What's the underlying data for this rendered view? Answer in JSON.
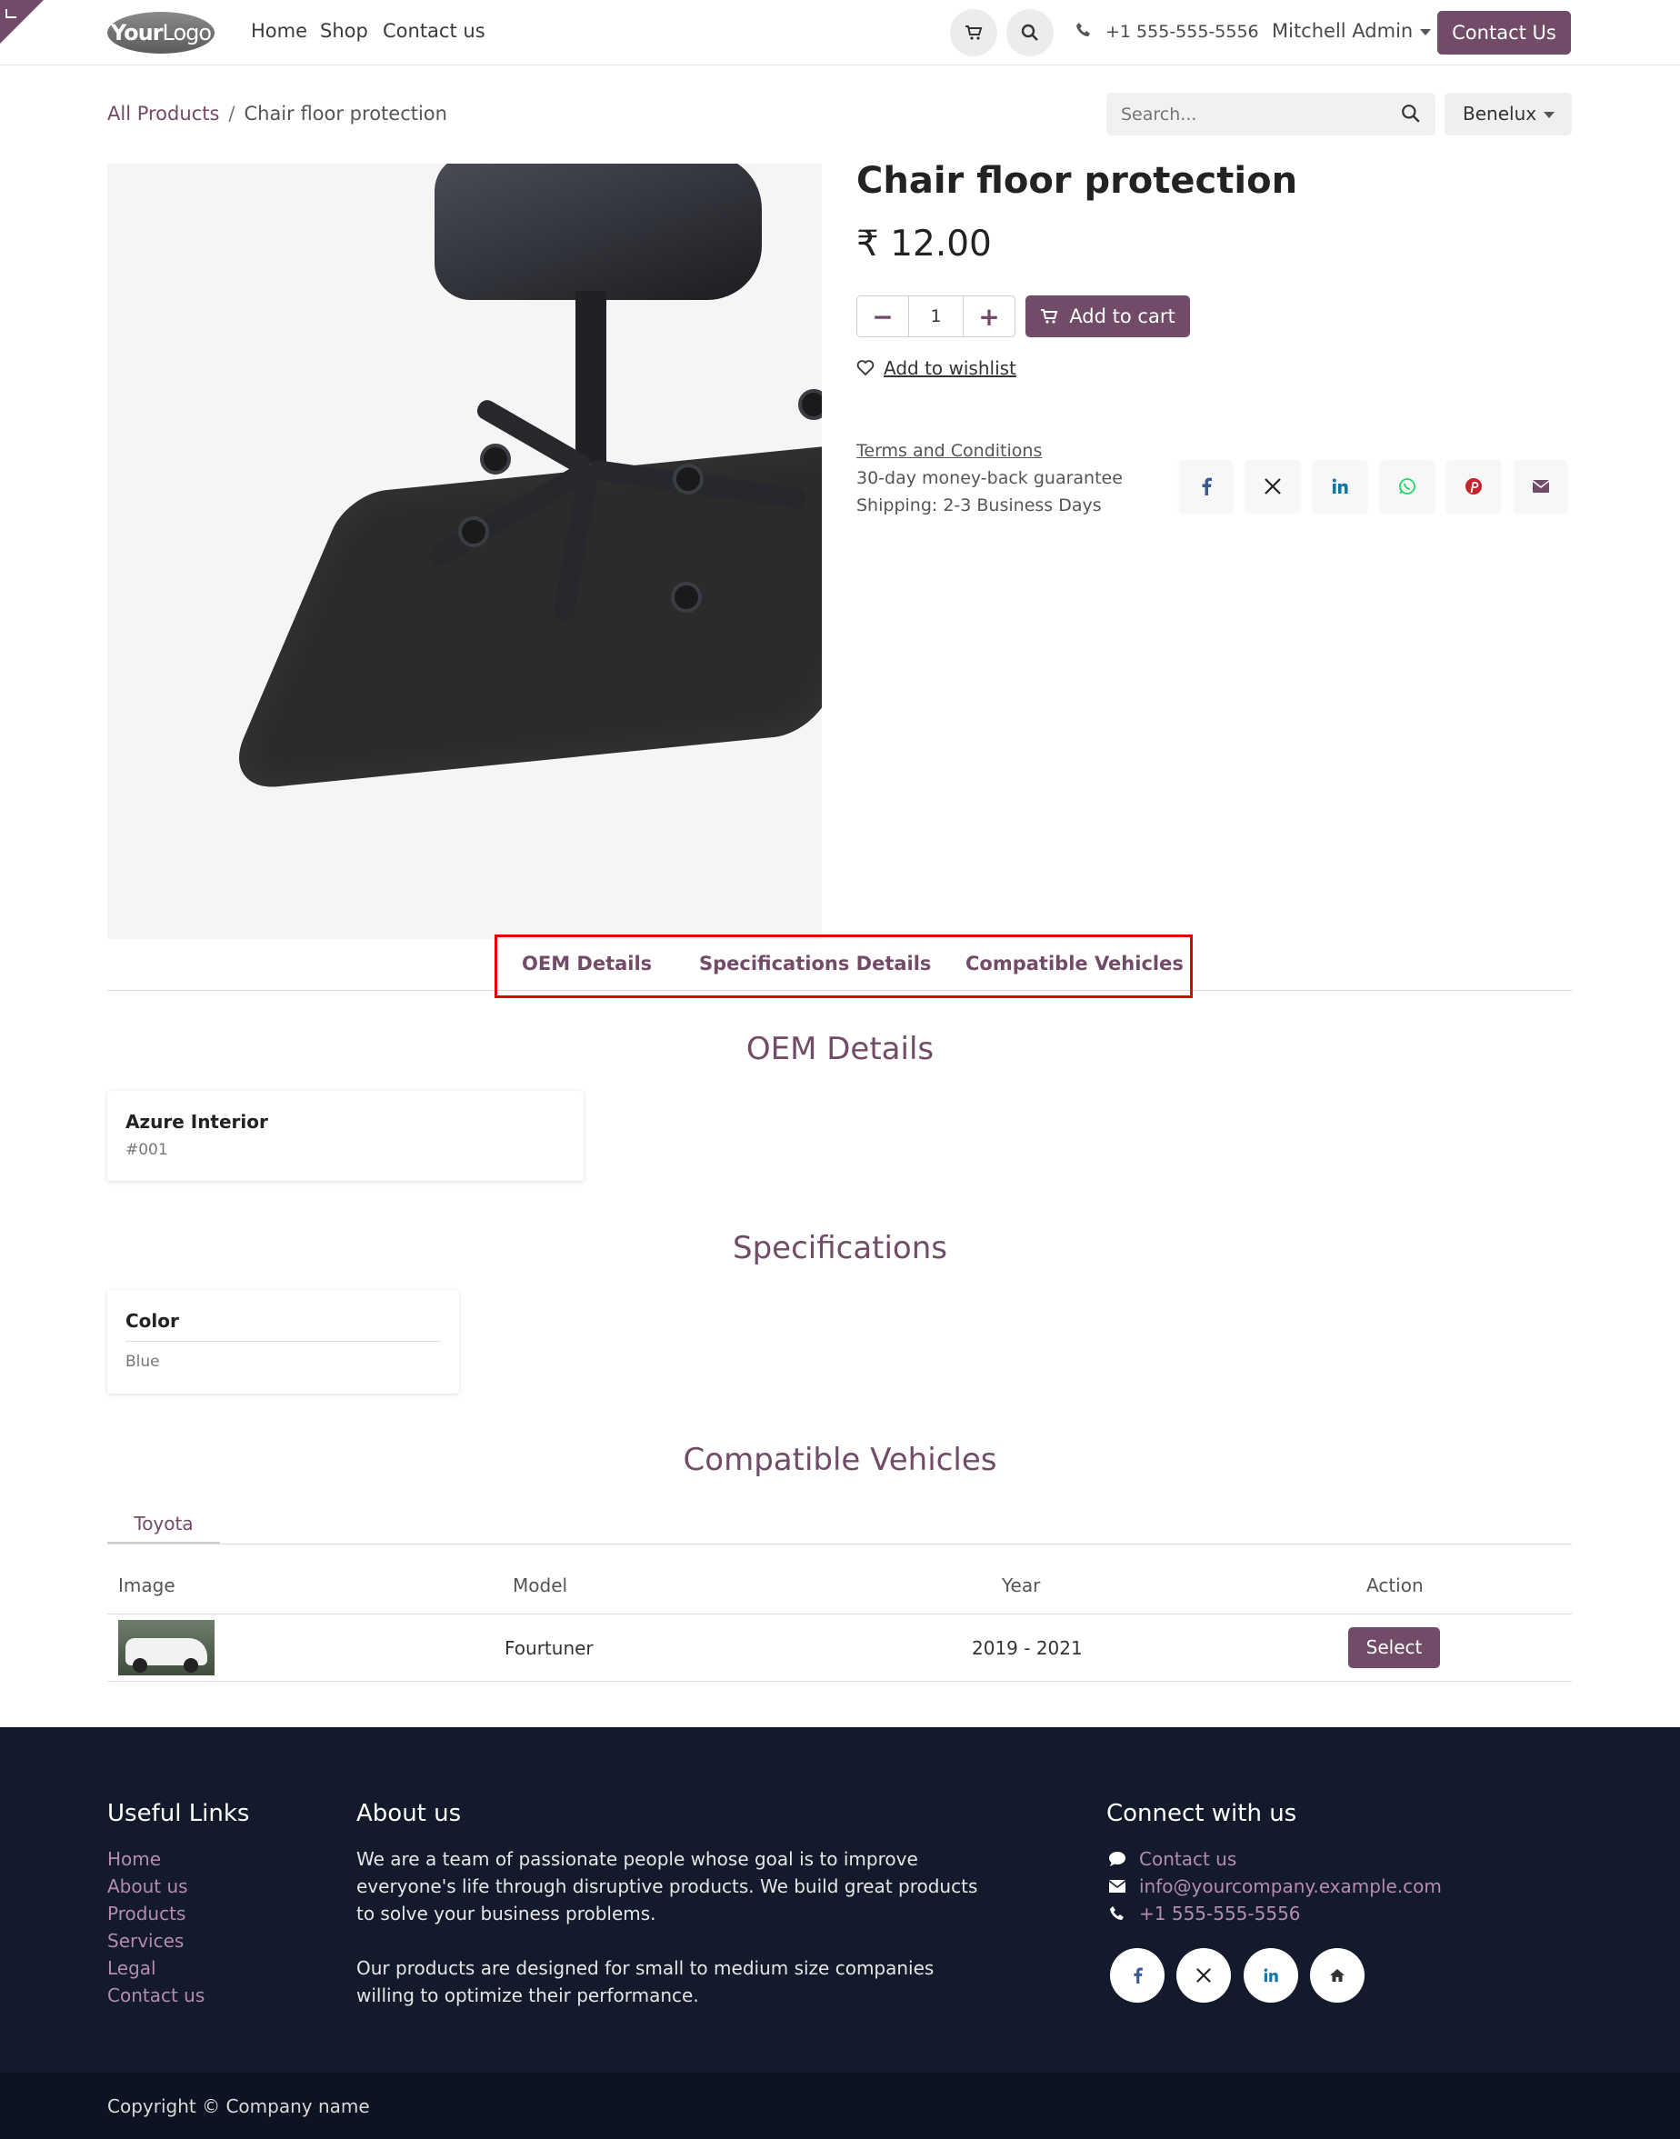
{
  "header": {
    "logo_text": "YourLogo",
    "nav": [
      "Home",
      "Shop",
      "Contact us"
    ],
    "phone": "+1 555-555-5556",
    "user": "Mitchell Admin",
    "contact_button": "Contact Us"
  },
  "breadcrumb": {
    "root": "All Products",
    "current": "Chair floor protection"
  },
  "search": {
    "placeholder": "Search..."
  },
  "pricelist": "Benelux",
  "product": {
    "name": "Chair floor protection",
    "price": "₹ 12.00",
    "quantity": "1",
    "add_to_cart": "Add to cart",
    "wishlist": "Add to wishlist",
    "terms": "Terms and Conditions",
    "guarantee": "30-day money-back guarantee",
    "shipping": "Shipping: 2-3 Business Days",
    "share_icons": [
      "facebook-icon",
      "x-icon",
      "linkedin-icon",
      "whatsapp-icon",
      "pinterest-icon",
      "email-icon"
    ]
  },
  "tabs": [
    "OEM Details",
    "Specifications Details",
    "Compatible Vehicles"
  ],
  "oem": {
    "title": "OEM Details",
    "name": "Azure Interior",
    "code": "#001"
  },
  "specs": {
    "title": "Specifications",
    "label": "Color",
    "value": "Blue"
  },
  "vehicles": {
    "title": "Compatible Vehicles",
    "brand_tab": "Toyota",
    "columns": [
      "Image",
      "Model",
      "Year",
      "Action"
    ],
    "rows": [
      {
        "model": "Fourtuner",
        "year": "2019 - 2021",
        "action": "Select"
      }
    ]
  },
  "footer": {
    "useful_links_title": "Useful Links",
    "useful_links": [
      "Home",
      "About us",
      "Products",
      "Services",
      "Legal",
      "Contact us"
    ],
    "about_title": "About us",
    "about_p1_l1": "We are a team of passionate people whose goal is to improve",
    "about_p1_l2": "everyone's life through disruptive products. We build great products",
    "about_p1_l3": "to solve your business problems.",
    "about_p2_l1": "Our products are designed for small to medium size companies",
    "about_p2_l2": "willing to optimize their performance.",
    "connect_title": "Connect with us",
    "connect_contact": "Contact us",
    "connect_email": "info@yourcompany.example.com",
    "connect_phone": "+1 555-555-5556",
    "copyright": "Copyright © Company name"
  },
  "colors": {
    "brand": "#714b67",
    "footer_bg": "#131a2c",
    "highlight": "#e30000"
  }
}
